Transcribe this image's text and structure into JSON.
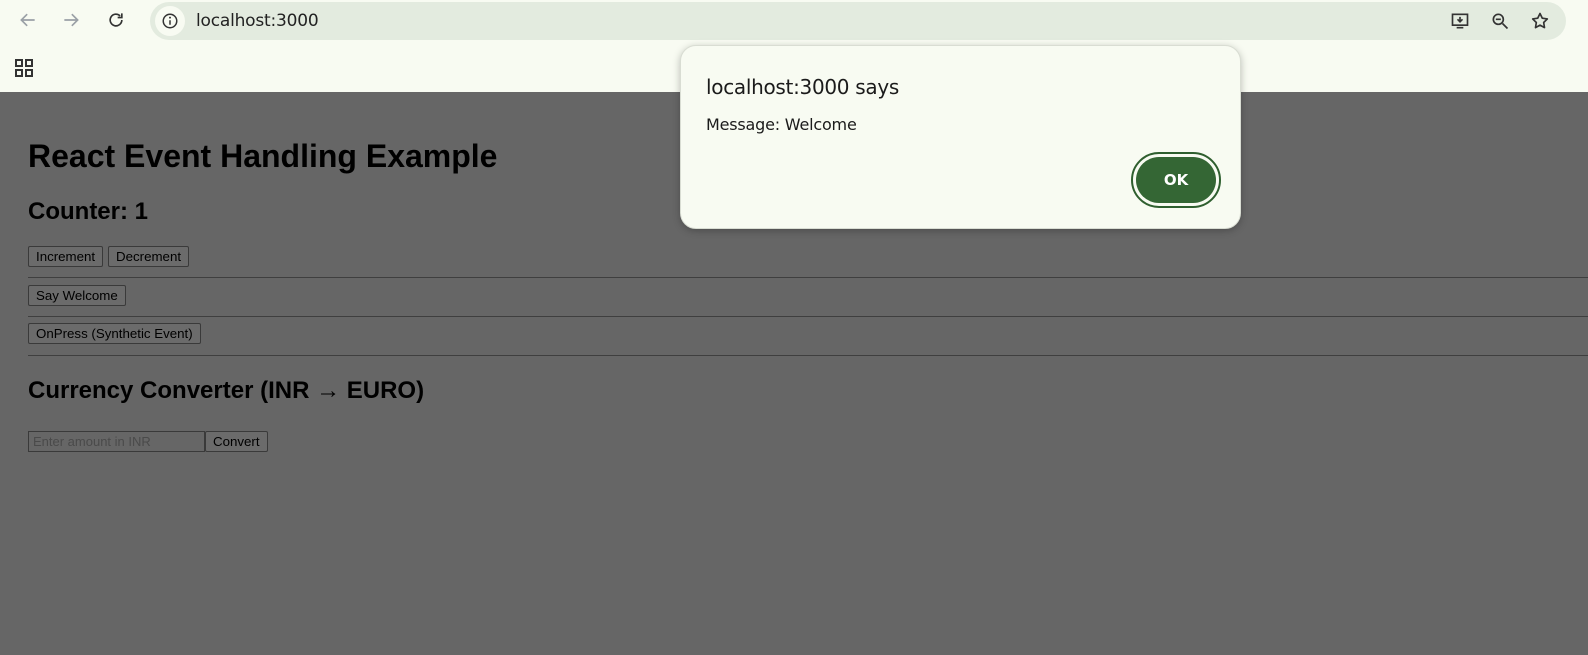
{
  "browser": {
    "url": "localhost:3000",
    "icons": [
      "back-icon",
      "forward-icon",
      "reload-icon",
      "site-info-icon",
      "install-app-icon",
      "zoom-out-icon",
      "bookmark-star-icon",
      "apps-grid-icon"
    ]
  },
  "page": {
    "heading": "React Event Handling Example",
    "counter_label": "Counter: 1",
    "buttons": {
      "increment": "Increment",
      "decrement": "Decrement",
      "say_welcome": "Say Welcome",
      "on_press": "OnPress (Synthetic Event)",
      "convert": "Convert"
    },
    "converter": {
      "heading": "Currency Converter (INR → EURO)",
      "placeholder": "Enter amount in INR",
      "value": ""
    }
  },
  "dialog": {
    "title": "localhost:3000 says",
    "message": "Message: Welcome",
    "ok_label": "OK"
  },
  "colors": {
    "chrome_bg": "#f8fbf2",
    "omnibox_bg": "#e3ebdf",
    "overlay_page": "#666666",
    "ok_button": "#346634"
  }
}
